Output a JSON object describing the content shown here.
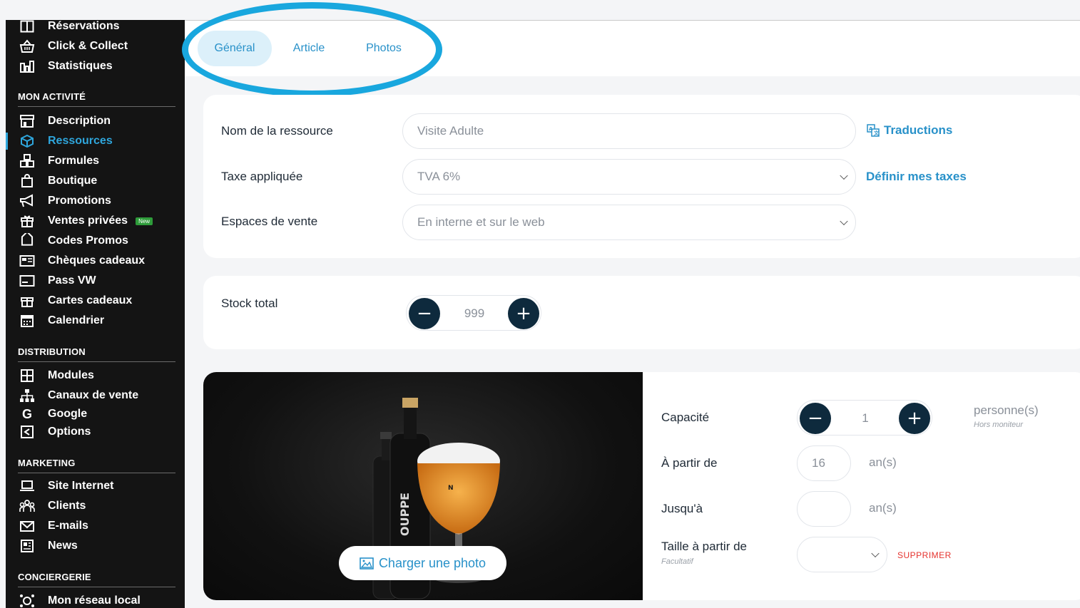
{
  "sidebar": {
    "top_items": [
      {
        "label": "Réservations",
        "icon": "book-icon"
      },
      {
        "label": "Click & Collect",
        "icon": "basket-icon"
      },
      {
        "label": "Statistiques",
        "icon": "bar-chart-icon"
      }
    ],
    "sections": [
      {
        "title": "MON ACTIVITÉ",
        "items": [
          {
            "label": "Description",
            "icon": "storefront-icon"
          },
          {
            "label": "Ressources",
            "icon": "cube-icon",
            "active": true
          },
          {
            "label": "Formules",
            "icon": "boxes-icon"
          },
          {
            "label": "Boutique",
            "icon": "shopping-bag-icon"
          },
          {
            "label": "Promotions",
            "icon": "megaphone-icon"
          },
          {
            "label": "Ventes privées",
            "icon": "gift-icon",
            "badge": "New"
          },
          {
            "label": "Codes Promos",
            "icon": "tag-icon"
          },
          {
            "label": "Chèques cadeaux",
            "icon": "voucher-icon"
          },
          {
            "label": "Pass VW",
            "icon": "pass-card-icon"
          },
          {
            "label": "Cartes cadeaux",
            "icon": "gift-card-icon"
          },
          {
            "label": "Calendrier",
            "icon": "calendar-icon"
          }
        ]
      },
      {
        "title": "DISTRIBUTION",
        "items": [
          {
            "label": "Modules",
            "icon": "grid-icon"
          },
          {
            "label": "Canaux de vente",
            "icon": "sitemap-icon"
          },
          {
            "label": "Google",
            "icon": "google-icon"
          },
          {
            "label": "Options",
            "icon": "options-icon"
          }
        ]
      },
      {
        "title": "MARKETING",
        "items": [
          {
            "label": "Site Internet",
            "icon": "laptop-icon"
          },
          {
            "label": "Clients",
            "icon": "users-icon"
          },
          {
            "label": "E-mails",
            "icon": "envelope-icon"
          },
          {
            "label": "News",
            "icon": "newspaper-icon"
          }
        ]
      },
      {
        "title": "CONCIERGERIE",
        "items": [
          {
            "label": "Mon réseau local",
            "icon": "network-icon"
          }
        ]
      }
    ]
  },
  "tabs": [
    {
      "label": "Général",
      "active": true
    },
    {
      "label": "Article"
    },
    {
      "label": "Photos"
    }
  ],
  "general": {
    "name_label": "Nom de la ressource",
    "name_value": "Visite Adulte",
    "translations_link": "Traductions",
    "tax_label": "Taxe appliquée",
    "tax_value": "TVA 6%",
    "tax_link": "Définir mes taxes",
    "sales_label": "Espaces de vente",
    "sales_value": "En interne et sur le web"
  },
  "stock": {
    "label": "Stock total",
    "value": "999",
    "minus": "−",
    "plus": "+"
  },
  "photo": {
    "upload_label": "Charger une photo",
    "bottle_text": "OUPPE"
  },
  "capacity": {
    "label": "Capacité",
    "value": "1",
    "minus": "−",
    "plus": "+",
    "unit": "personne(s)",
    "hint": "Hors moniteur"
  },
  "age_from": {
    "label": "À partir de",
    "value": "16",
    "unit": "an(s)"
  },
  "age_to": {
    "label": "Jusqu'à",
    "value": "",
    "unit": "an(s)"
  },
  "height_from": {
    "label": "Taille à partir de",
    "hint": "Facultatif",
    "value": "",
    "delete_label": "SUPPRIMER"
  },
  "colors": {
    "accent": "#2891c9",
    "dark_button": "#0e2a3d",
    "sidebar_bg": "#141414",
    "danger": "#e5322d",
    "annotation": "#19a7de"
  }
}
